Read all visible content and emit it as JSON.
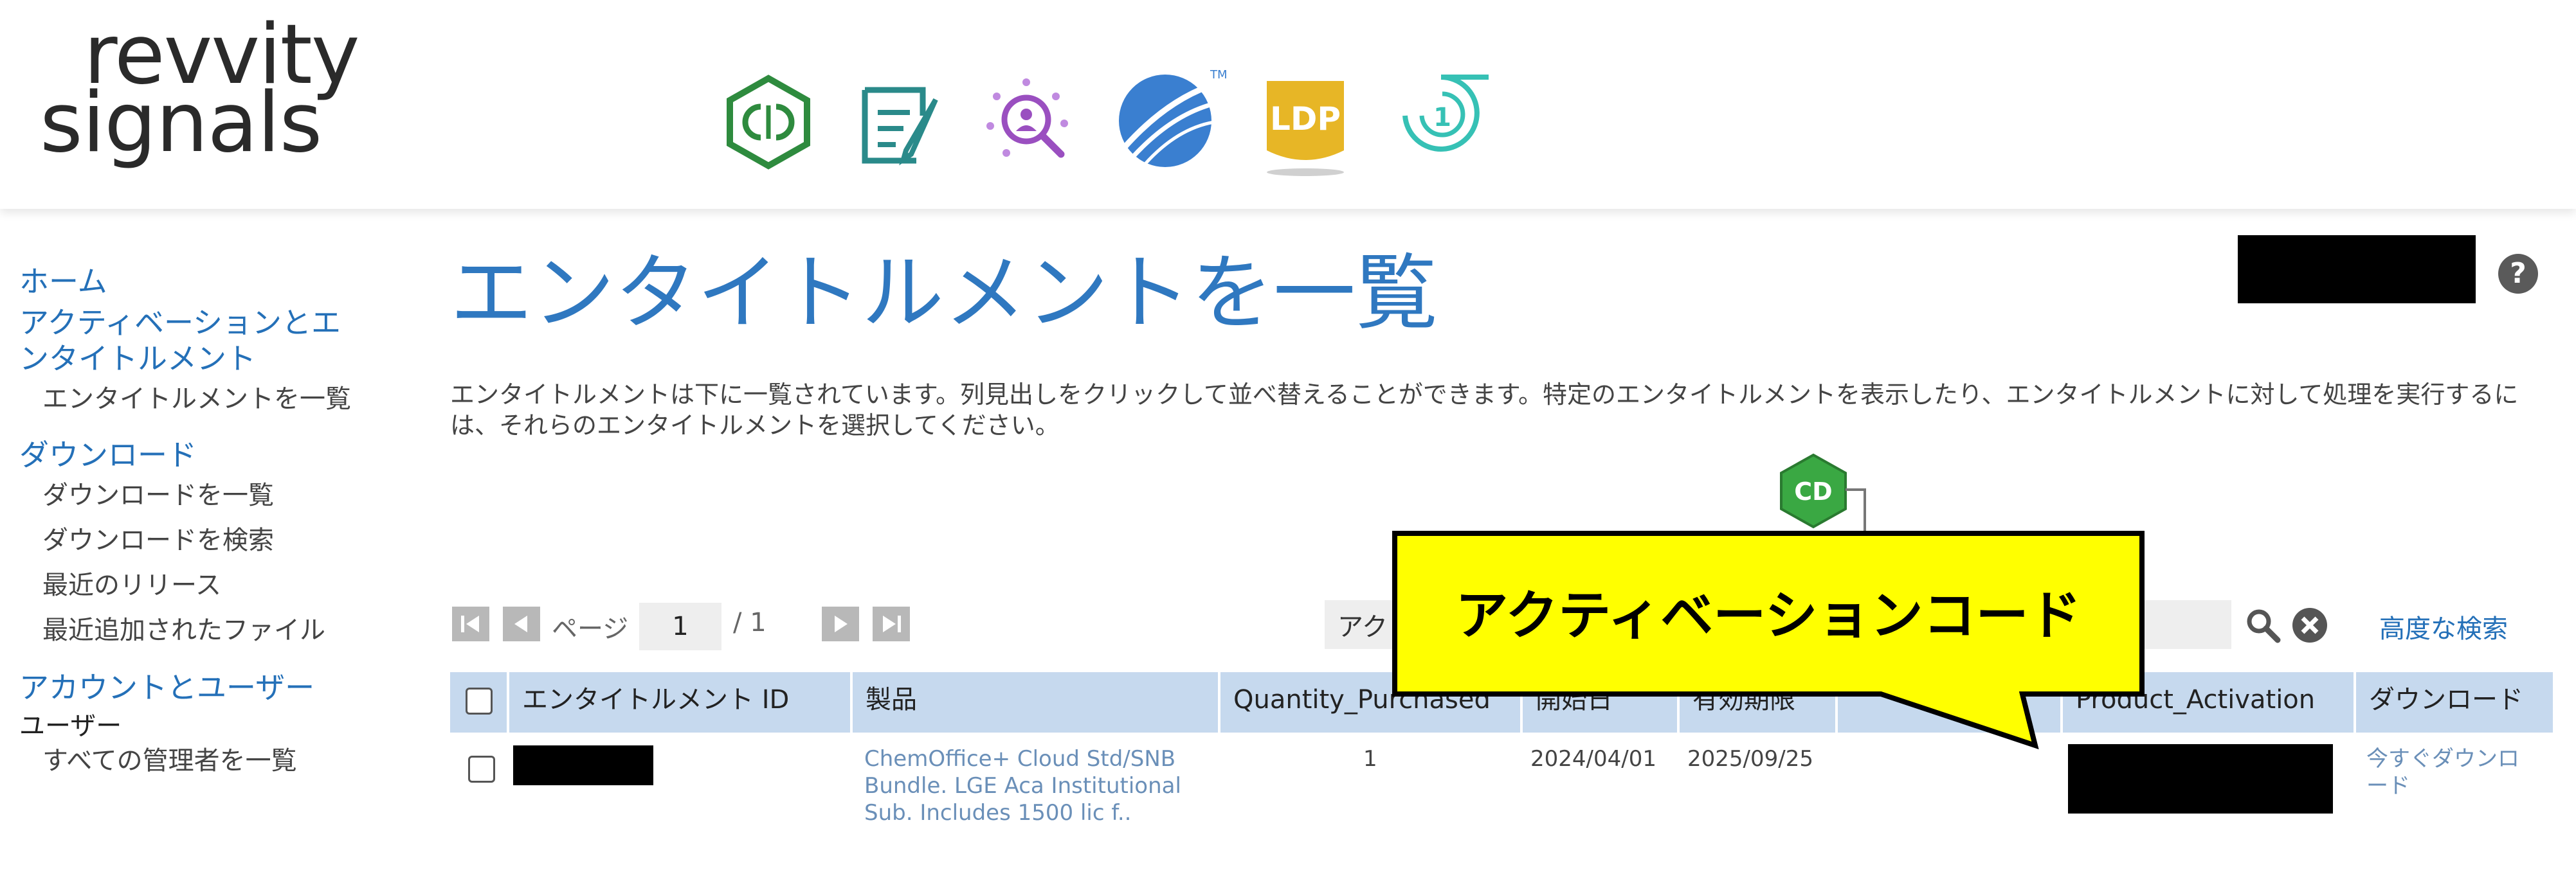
{
  "header": {
    "logo_top": "revvity",
    "logo_bottom": "signals",
    "app_icons": [
      {
        "name": "chemdraw-hexagon-icon",
        "color": "#2e8b3e"
      },
      {
        "name": "notebook-icon",
        "color": "#2a8a8a"
      },
      {
        "name": "insight-search-icon",
        "color": "#9a4fc0"
      },
      {
        "name": "blue-ball-icon",
        "color": "#3a7fd0"
      },
      {
        "name": "ldp-icon",
        "color": "#e7b626",
        "label": "LDP"
      },
      {
        "name": "one-swirl-icon",
        "color": "#36c1b5",
        "label": "1"
      }
    ]
  },
  "sidebar": {
    "home": "ホーム",
    "activation_section": "アクティベーションとエンタイトルメント",
    "activation_section_line1": "アクティベーションとエ",
    "activation_section_line2": "ンタイトルメント",
    "activation_items": [
      "エンタイトルメントを一覧"
    ],
    "download_section": "ダウンロード",
    "download_items": [
      "ダウンロードを一覧",
      "ダウンロードを検索",
      "最近のリリース",
      "最近追加されたファイル"
    ],
    "account_section": "アカウントとユーザー",
    "users_label": "ユーザー",
    "users_items": [
      "すべての管理者を一覧"
    ]
  },
  "main": {
    "title": "エンタイトルメントを一覧",
    "description": "エンタイトルメントは下に一覧されています。列見出しをクリックして並べ替えることができます。特定のエンタイトルメントを表示したり、エンタイトルメントに対して処理を実行するには、それらのエンタイトルメントを選択してください。",
    "help_glyph": "?"
  },
  "pager": {
    "label": "ページ",
    "current": "1",
    "total": "/ 1"
  },
  "search": {
    "value": "アク",
    "advanced": "高度な検索"
  },
  "table": {
    "columns": [
      "エンタイトルメント ID",
      "製品",
      "Quantity_Purchased",
      "開始日",
      "有効期限",
      "",
      "Product_Activation",
      "ダウンロード"
    ],
    "rows": [
      {
        "product": "ChemOffice+ Cloud Std/SNB Bundle. LGE Aca Institutional Sub. Includes 1500 lic f..",
        "product_line1": "ChemOffice+ Cloud Std/SNB",
        "product_line2": "Bundle. LGE Aca Institutional",
        "product_line3": "Sub. Includes 1500 lic f..",
        "quantity": "1",
        "start": "2024/04/01",
        "end": "2025/09/25",
        "download": "今すぐダウンロード",
        "download_line1": "今すぐダウンロ",
        "download_line2": "ード"
      }
    ]
  },
  "callout": {
    "text": "アクティベーションコード",
    "fill": "#ffff00",
    "badge": "CD",
    "badge_color": "#3aa843"
  }
}
